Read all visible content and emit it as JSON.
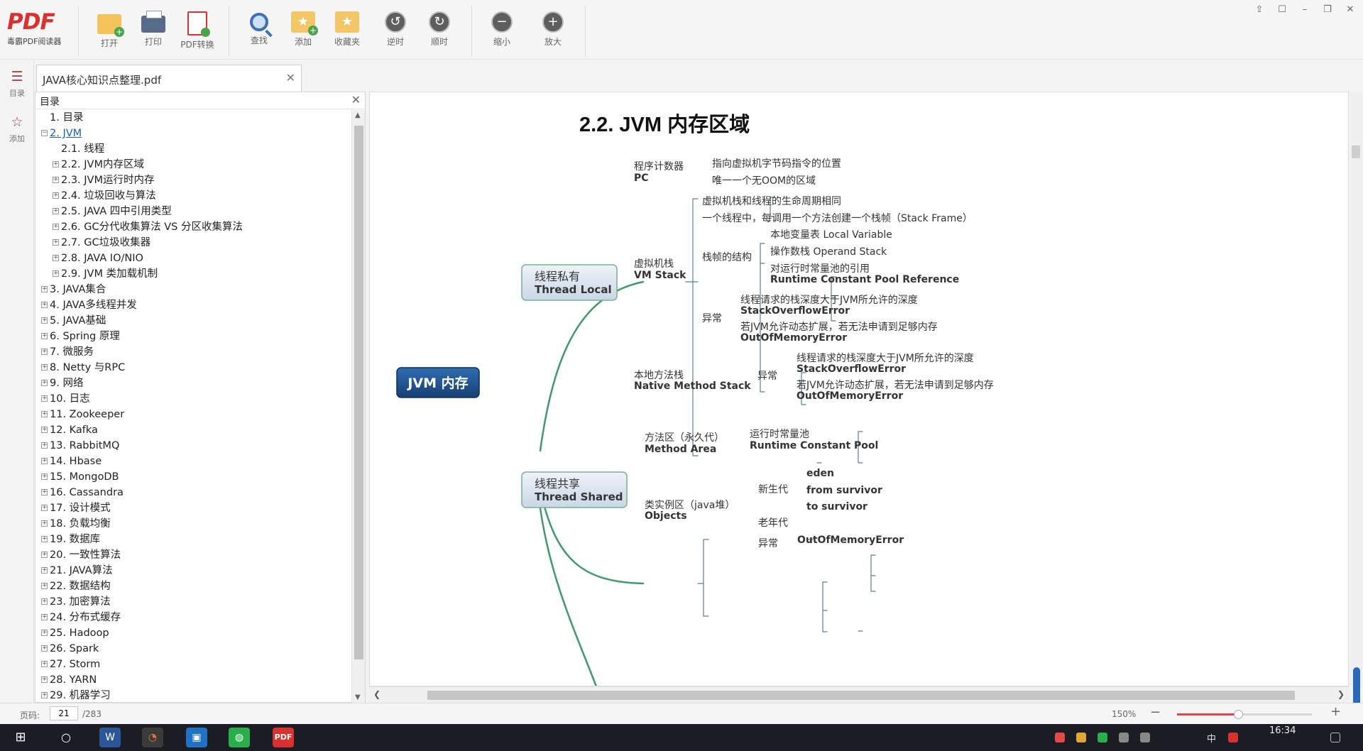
{
  "app": {
    "logo_text": "PDF",
    "logo_subtitle": "毒霸PDF阅读器"
  },
  "toolbar": {
    "buttons": [
      {
        "label": "打开",
        "icon": "open-folder-icon"
      },
      {
        "label": "打印",
        "icon": "printer-icon"
      },
      {
        "label": "PDF转换",
        "icon": "pdf-convert-icon"
      },
      {
        "label": "查找",
        "icon": "search-icon"
      },
      {
        "label": "添加",
        "icon": "add-bookmark-icon"
      },
      {
        "label": "收藏夹",
        "icon": "favorites-icon"
      },
      {
        "label": "逆时",
        "icon": "rotate-ccw-icon"
      },
      {
        "label": "顺时",
        "icon": "rotate-cw-icon"
      },
      {
        "label": "缩小",
        "icon": "zoom-out-icon"
      },
      {
        "label": "放大",
        "icon": "zoom-in-icon"
      }
    ]
  },
  "sidebar": {
    "items": [
      {
        "label": "目录",
        "icon": "toc-list-icon"
      },
      {
        "label": "添加",
        "icon": "star-icon"
      }
    ]
  },
  "tab": {
    "title": "JAVA核心知识点整理.pdf"
  },
  "toc": {
    "title": "目录",
    "items": [
      {
        "label": "1. 目录",
        "level": 0,
        "expander": ""
      },
      {
        "label": "2. JVM",
        "level": 0,
        "expander": "−",
        "active": true
      },
      {
        "label": "2.1. 线程",
        "level": 1,
        "expander": ""
      },
      {
        "label": "2.2. JVM内存区域",
        "level": 1,
        "expander": "+"
      },
      {
        "label": "2.3. JVM运行时内存",
        "level": 1,
        "expander": "+"
      },
      {
        "label": "2.4. 垃圾回收与算法",
        "level": 1,
        "expander": "+"
      },
      {
        "label": "2.5. JAVA 四中引用类型",
        "level": 1,
        "expander": "+"
      },
      {
        "label": "2.6. GC分代收集算法 VS 分区收集算法",
        "level": 1,
        "expander": "+"
      },
      {
        "label": "2.7. GC垃圾收集器",
        "level": 1,
        "expander": "+"
      },
      {
        "label": "2.8. JAVA IO/NIO",
        "level": 1,
        "expander": "+"
      },
      {
        "label": "2.9. JVM 类加载机制",
        "level": 1,
        "expander": "+"
      },
      {
        "label": "3. JAVA集合",
        "level": 0,
        "expander": "+"
      },
      {
        "label": "4. JAVA多线程并发",
        "level": 0,
        "expander": "+"
      },
      {
        "label": "5. JAVA基础",
        "level": 0,
        "expander": "+"
      },
      {
        "label": "6. Spring 原理",
        "level": 0,
        "expander": "+"
      },
      {
        "label": "7. 微服务",
        "level": 0,
        "expander": "+"
      },
      {
        "label": "8. Netty 与RPC",
        "level": 0,
        "expander": "+"
      },
      {
        "label": "9. 网络",
        "level": 0,
        "expander": "+"
      },
      {
        "label": "10. 日志",
        "level": 0,
        "expander": "+"
      },
      {
        "label": "11. Zookeeper",
        "level": 0,
        "expander": "+"
      },
      {
        "label": "12. Kafka",
        "level": 0,
        "expander": "+"
      },
      {
        "label": "13. RabbitMQ",
        "level": 0,
        "expander": "+"
      },
      {
        "label": "14. Hbase",
        "level": 0,
        "expander": "+"
      },
      {
        "label": "15. MongoDB",
        "level": 0,
        "expander": "+"
      },
      {
        "label": "16. Cassandra",
        "level": 0,
        "expander": "+"
      },
      {
        "label": "17. 设计模式",
        "level": 0,
        "expander": "+"
      },
      {
        "label": "18. 负载均衡",
        "level": 0,
        "expander": "+"
      },
      {
        "label": "19. 数据库",
        "level": 0,
        "expander": "+"
      },
      {
        "label": "20. 一致性算法",
        "level": 0,
        "expander": "+"
      },
      {
        "label": "21. JAVA算法",
        "level": 0,
        "expander": "+"
      },
      {
        "label": "22. 数据结构",
        "level": 0,
        "expander": "+"
      },
      {
        "label": "23. 加密算法",
        "level": 0,
        "expander": "+"
      },
      {
        "label": "24. 分布式缓存",
        "level": 0,
        "expander": "+"
      },
      {
        "label": "25. Hadoop",
        "level": 0,
        "expander": "+"
      },
      {
        "label": "26. Spark",
        "level": 0,
        "expander": "+"
      },
      {
        "label": "27. Storm",
        "level": 0,
        "expander": "+"
      },
      {
        "label": "28. YARN",
        "level": 0,
        "expander": "+"
      },
      {
        "label": "29. 机器学习",
        "level": 0,
        "expander": "+"
      }
    ]
  },
  "document": {
    "heading": "2.2. JVM 内存区域",
    "mindmap": {
      "root": "JVM 内存",
      "thread_local": [
        "线程私有",
        "Thread Local"
      ],
      "thread_shared": [
        "线程共享",
        "Thread Shared"
      ],
      "pc": [
        "程序计数器",
        "PC"
      ],
      "pc_items": [
        "指向虚拟机字节码指令的位置",
        "唯一一个无OOM的区域"
      ],
      "vm_stack": [
        "虚拟机栈",
        "VM Stack"
      ],
      "vm_items": [
        "虚拟机栈和线程的生命周期相同",
        "一个线程中，每调用一个方法创建一个栈帧（Stack Frame）"
      ],
      "frame_structure": "栈帧的结构",
      "frame_items": [
        "本地变量表 Local Variable",
        "操作数栈 Operand Stack",
        "对运行时常量池的引用",
        "Runtime Constant Pool Reference"
      ],
      "exception": "异常",
      "vm_exc_items": [
        "线程请求的栈深度大于JVM所允许的深度",
        "StackOverflowError",
        "若JVM允许动态扩展，若无法申请到足够内存",
        "OutOfMemoryError"
      ],
      "native": [
        "本地方法栈",
        "Native Method Stack"
      ],
      "native_exc_items": [
        "线程请求的栈深度大于JVM所允许的深度",
        "StackOverflowError",
        "若JVM允许动态扩展，若无法申请到足够内存",
        "OutOfMemoryError"
      ],
      "method_area": [
        "方法区（永久代）",
        "Method Area"
      ],
      "method_items": [
        "运行时常量池",
        "Runtime Constant Pool"
      ],
      "objects": [
        "类实例区（java堆）",
        "Objects"
      ],
      "young": "新生代",
      "young_items": [
        "eden",
        "from survivor",
        "to survivor"
      ],
      "old": "老年代",
      "heap_exc": "异常",
      "heap_exc_item": "OutOfMemoryError"
    }
  },
  "status": {
    "page_label": "页码:",
    "page_current": "21",
    "page_total": "/283",
    "zoom_level": "150%",
    "zoom_slider_fraction": 0.45
  },
  "taskbar": {
    "time": "16:34",
    "ime": "中"
  },
  "colors": {
    "accent": "#d9322e",
    "link": "#1a5fb4",
    "branch": "#3f9a6a",
    "root_node": "#1d4f8c"
  }
}
